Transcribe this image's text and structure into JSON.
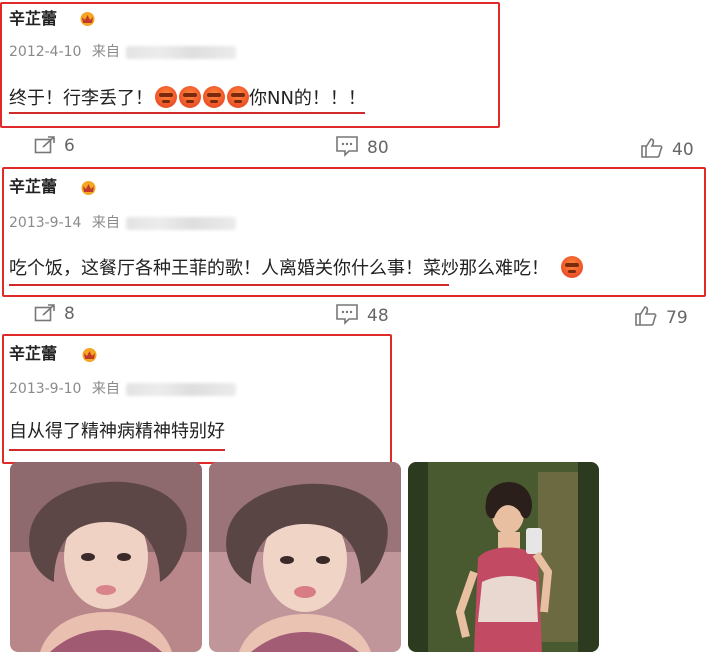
{
  "posts": [
    {
      "username": "辛芷蕾",
      "date": "2012-4-10",
      "source_label": "来自",
      "text_before": "终于！行李丢了！",
      "text_after": "你NN的！！！",
      "emoji_count_before": 4,
      "emoji_count_after": 0,
      "reposts": "6",
      "comments": "80",
      "likes": "40"
    },
    {
      "username": "辛芷蕾",
      "date": "2013-9-14",
      "source_label": "来自",
      "text_before": "吃个饭，这餐厅各种王菲的歌！人离婚关你什么事！菜炒那么难吃！",
      "text_after": "",
      "emoji_count_before": 0,
      "emoji_count_after": 1,
      "reposts": "8",
      "comments": "48",
      "likes": "79"
    },
    {
      "username": "辛芷蕾",
      "date": "2013-9-10",
      "source_label": "来自",
      "text_before": "自从得了精神病精神特别好",
      "text_after": ""
    }
  ],
  "photos": [
    "selfie-photo-1",
    "selfie-photo-2",
    "mirror-selfie-photo"
  ],
  "colors": {
    "highlight_box": "#e02a2a",
    "underline": "#d12a2a",
    "emoji": "#f0562a",
    "crown": "#f5a623"
  }
}
